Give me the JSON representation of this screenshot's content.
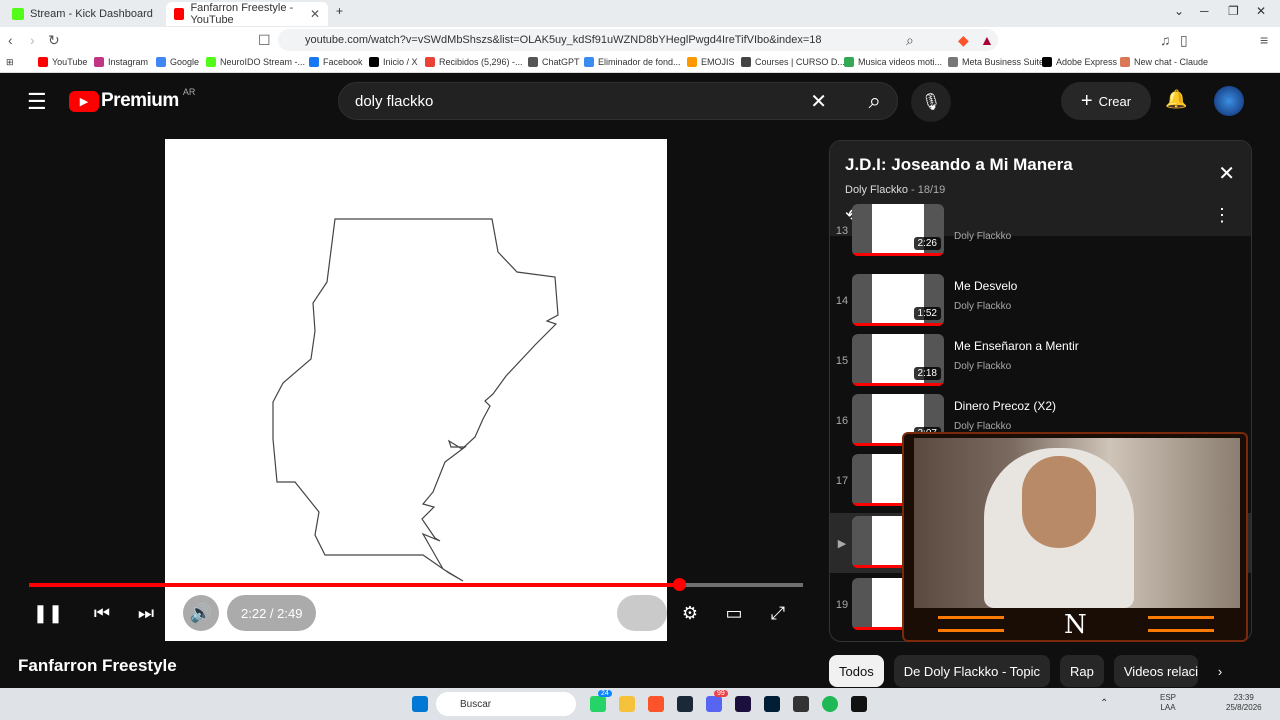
{
  "browser": {
    "tabs": [
      {
        "title": "Stream - Kick Dashboard",
        "active": false
      },
      {
        "title": "Fanfarron Freestyle - YouTube",
        "active": true
      }
    ],
    "url": "youtube.com/watch?v=vSWdMbShszs&list=OLAK5uy_kdSf91uWZND8bYHeglPwgd4IreTifVIbo&index=18",
    "bookmarks": [
      "YouTube",
      "Instagram",
      "Google",
      "NeuroIDO Stream -...",
      "Facebook",
      "Inicio / X",
      "Recibidos (5,296) -...",
      "ChatGPT",
      "Eliminador de fond...",
      "EMOJIS",
      "Courses | CURSO D...",
      "Musica videos moti...",
      "Meta Business Suite",
      "Adobe Express",
      "New chat - Claude"
    ]
  },
  "youtube": {
    "logo": "Premium",
    "region": "AR",
    "search_value": "doly flackko",
    "create_label": "Crear"
  },
  "player": {
    "video_title": "Fanfarron Freestyle",
    "time": "2:22 / 2:49",
    "progress": 0.84
  },
  "playlist": {
    "title": "J.D.I: Joseando a Mi Manera",
    "artist": "Doly Flackko",
    "position": "18/19",
    "items": [
      {
        "index": "13",
        "name": "",
        "artist": "Doly Flackko",
        "duration": "2:26"
      },
      {
        "index": "14",
        "name": "Me Desvelo",
        "artist": "Doly Flackko",
        "duration": "1:52"
      },
      {
        "index": "15",
        "name": "Me Enseñaron a Mentir",
        "artist": "Doly Flackko",
        "duration": "2:18"
      },
      {
        "index": "16",
        "name": "Dinero Precoz (X2)",
        "artist": "Doly Flackko",
        "duration": "2:07"
      },
      {
        "index": "17",
        "name": "",
        "artist": "",
        "duration": ""
      },
      {
        "index": "▶",
        "name": "",
        "artist": "",
        "duration": ""
      },
      {
        "index": "19",
        "name": "",
        "artist": "",
        "duration": ""
      }
    ]
  },
  "chips": [
    "Todos",
    "De Doly Flackko - Topic",
    "Rap",
    "Videos relacio"
  ],
  "taskbar": {
    "search_label": "Buscar",
    "lang": "ESP",
    "lang2": "LAA",
    "time": "23:39",
    "date": "25/8/2026",
    "badge1": "24",
    "badge2": "99"
  },
  "colors": {
    "accent": "#ff0000",
    "background": "#0f0f0f"
  }
}
